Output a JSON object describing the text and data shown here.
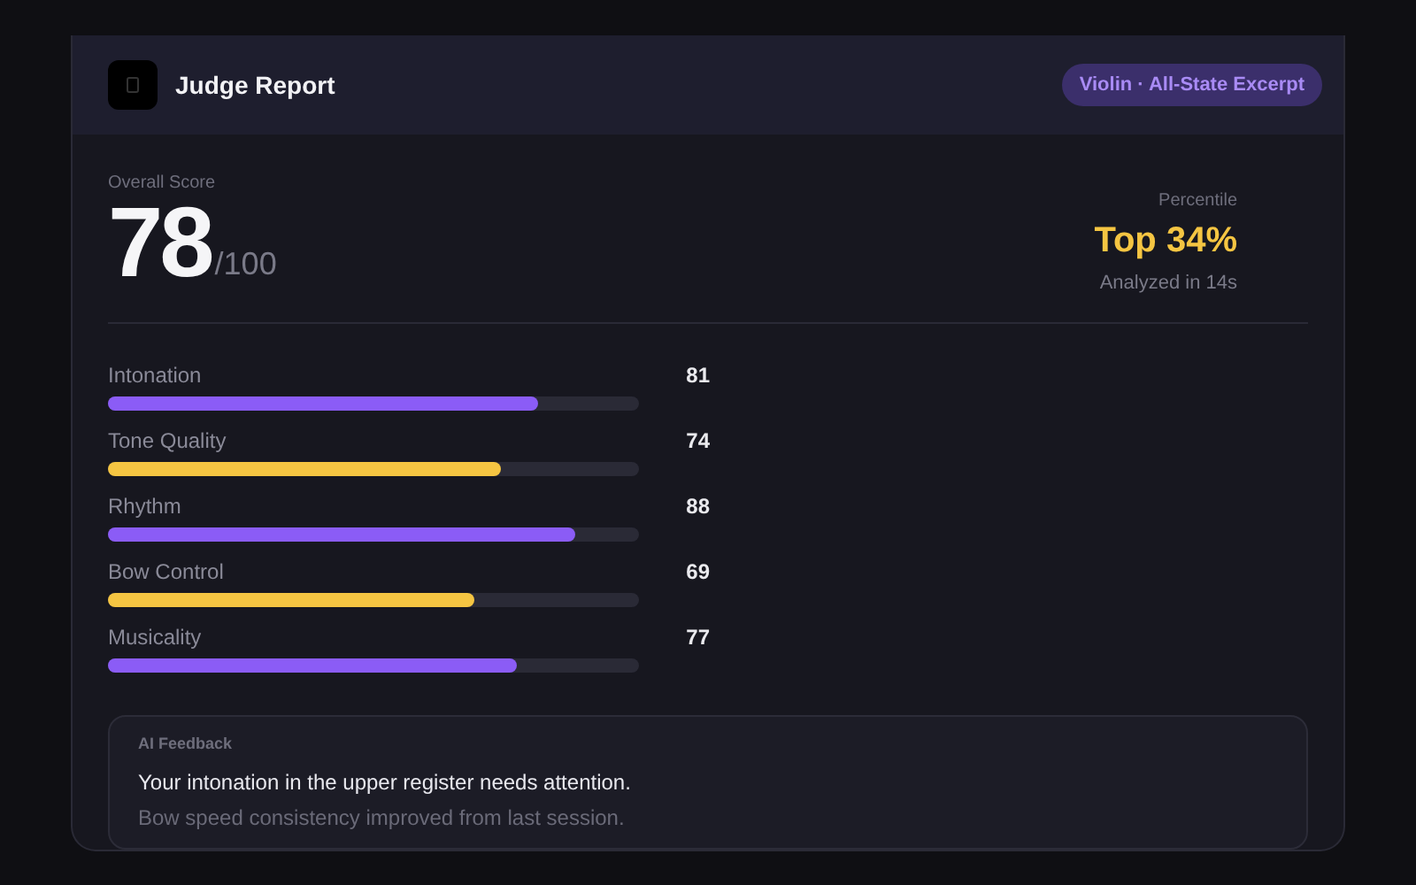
{
  "header": {
    "title": "Judge Report",
    "badge": "Violin · All-State Excerpt"
  },
  "score": {
    "label": "Overall Score",
    "value": "78",
    "max": "/100"
  },
  "percentile": {
    "label": "Percentile",
    "value": "Top 34%",
    "note": "Analyzed in 14s"
  },
  "metrics": [
    {
      "name": "Intonation",
      "score": "81",
      "level": 0.81,
      "color": "#8b5cf6"
    },
    {
      "name": "Tone Quality",
      "score": "74",
      "level": 0.74,
      "color": "#f5c542"
    },
    {
      "name": "Rhythm",
      "score": "88",
      "level": 0.88,
      "color": "#8b5cf6"
    },
    {
      "name": "Bow Control",
      "score": "69",
      "level": 0.69,
      "color": "#f5c542"
    },
    {
      "name": "Musicality",
      "score": "77",
      "level": 0.77,
      "color": "#8b5cf6"
    }
  ],
  "feedback": {
    "title": "AI Feedback",
    "lines": [
      {
        "text": "Your intonation in the upper register needs attention.",
        "kind": "primary"
      },
      {
        "text": "Bow speed consistency improved from last session.",
        "kind": "secondary"
      }
    ]
  }
}
